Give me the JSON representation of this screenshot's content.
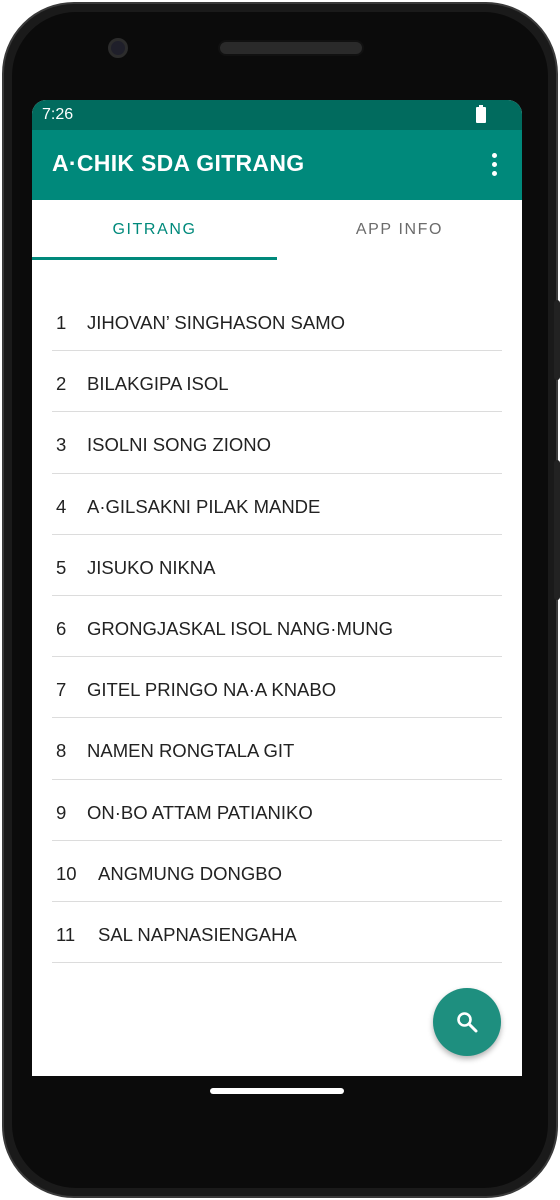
{
  "status_bar": {
    "time": "7:26",
    "icons": [
      "battery-icon"
    ]
  },
  "app_bar": {
    "title": "A·CHIK SDA GITRANG",
    "menu_icon": "overflow-menu-icon"
  },
  "tabs": [
    {
      "label": "GITRANG",
      "selected": true
    },
    {
      "label": "APP INFO",
      "selected": false
    }
  ],
  "songs": [
    {
      "number": "1",
      "title": "JIHOVAN’ SINGHASON SAMO"
    },
    {
      "number": "2",
      "title": "BILAKGIPA ISOL"
    },
    {
      "number": "3",
      "title": "ISOLNI SONG ZIONO"
    },
    {
      "number": "4",
      "title": "A·GILSAKNI PILAK MANDE"
    },
    {
      "number": "5",
      "title": "JISUKO NIKNA"
    },
    {
      "number": "6",
      "title": "GRONGJASKAL ISOL NANG·MUNG"
    },
    {
      "number": "7",
      "title": "GITEL PRINGO NA·A KNABO"
    },
    {
      "number": "8",
      "title": "NAMEN RONGTALA GIT"
    },
    {
      "number": "9",
      "title": "ON·BO ATTAM PATIANIKO"
    },
    {
      "number": "10",
      "title": "ANGMUNG DONGBO"
    },
    {
      "number": "11",
      "title": "SAL NAPNASIENGAHA"
    }
  ],
  "fab": {
    "icon": "search-icon"
  },
  "colors": {
    "primary": "#00897b",
    "primary_dark": "#016b5e",
    "fab": "#1e8f7f",
    "tab_inactive": "#6b6b6b"
  }
}
